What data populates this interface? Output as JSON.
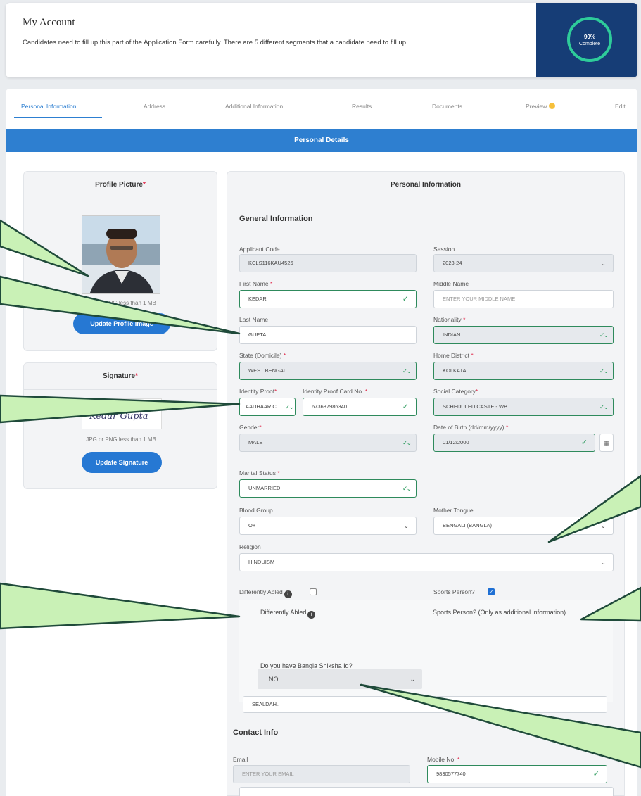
{
  "account": {
    "title": "My Account",
    "description": "Candidates need to fill up this part of the Application Form carefully. There are 5 different segments that a candidate need to fill up.",
    "progress_value": "90%",
    "progress_label": "Complete",
    "progress_fraction": 0.9
  },
  "tabs": [
    {
      "label": "Personal Information"
    },
    {
      "label": "Address"
    },
    {
      "label": "Additional Information"
    },
    {
      "label": "Results"
    },
    {
      "label": "Documents"
    },
    {
      "label": "Preview"
    },
    {
      "label": "Edit"
    }
  ],
  "section_title": "Personal Details",
  "profile": {
    "title": "Profile Picture",
    "hint": "JPG or PNG less than 1 MB",
    "button": "Update Profile Image"
  },
  "signature": {
    "title": "Signature",
    "signature_text": "Kedar Gupta",
    "hint": "JPG or PNG less than 1 MB",
    "button": "Update Signature"
  },
  "personal": {
    "title": "Personal Information",
    "general_title": "General Information",
    "applicant_code": {
      "label": "Applicant Code",
      "value": "KCLS116KAU4526"
    },
    "session": {
      "label": "Session",
      "value": "2023-24"
    },
    "first_name": {
      "label": "First Name",
      "value": "KEDAR"
    },
    "middle_name": {
      "label": "Middle Name",
      "placeholder": "ENTER YOUR MIDDLE NAME"
    },
    "last_name": {
      "label": "Last Name",
      "value": "GUPTA"
    },
    "nationality": {
      "label": "Nationality",
      "value": "INDIAN"
    },
    "state": {
      "label": "State (Domicile)",
      "value": "WEST BENGAL"
    },
    "home_district": {
      "label": "Home District",
      "value": "KOLKATA"
    },
    "identity_proof": {
      "label": "Identity Proof",
      "value": "AADHAAR C"
    },
    "identity_card": {
      "label": "Identity Proof Card No.",
      "value": "673687986340"
    },
    "social_category": {
      "label": "Social Category",
      "value": "SCHEDULED CASTE - WB"
    },
    "gender": {
      "label": "Gender",
      "value": "MALE"
    },
    "dob": {
      "label": "Date of Birth (dd/mm/yyyy)",
      "value": "01/12/2000"
    },
    "marital_status": {
      "label": "Marital Status",
      "value": "UNMARRIED"
    },
    "blood_group": {
      "label": "Blood Group",
      "value": "O+"
    },
    "mother_tongue": {
      "label": "Mother Tongue",
      "value": "BENGALI (BANGLA)"
    },
    "religion": {
      "label": "Religion",
      "value": "HINDUISM"
    },
    "differently_abled": "Differently Abled",
    "sports_person": "Sports Person?",
    "sports_person_extra": "Sports Person? (Only as additional information)",
    "bangla_shiksha": {
      "label": "Do you have Bangla Shiksha Id?",
      "value": "NO"
    },
    "partial_value": "SEALDAH..",
    "contact_title": "Contact Info",
    "email": {
      "label": "Email",
      "placeholder": "ENTER YOUR EMAIL"
    },
    "mobile": {
      "label": "Mobile No.",
      "value": "9830577740"
    }
  },
  "colors": {
    "accent": "#2e7fd0",
    "panel_dark": "#163d76",
    "success": "#2e8a5c",
    "callout": "#c9f1b6"
  }
}
